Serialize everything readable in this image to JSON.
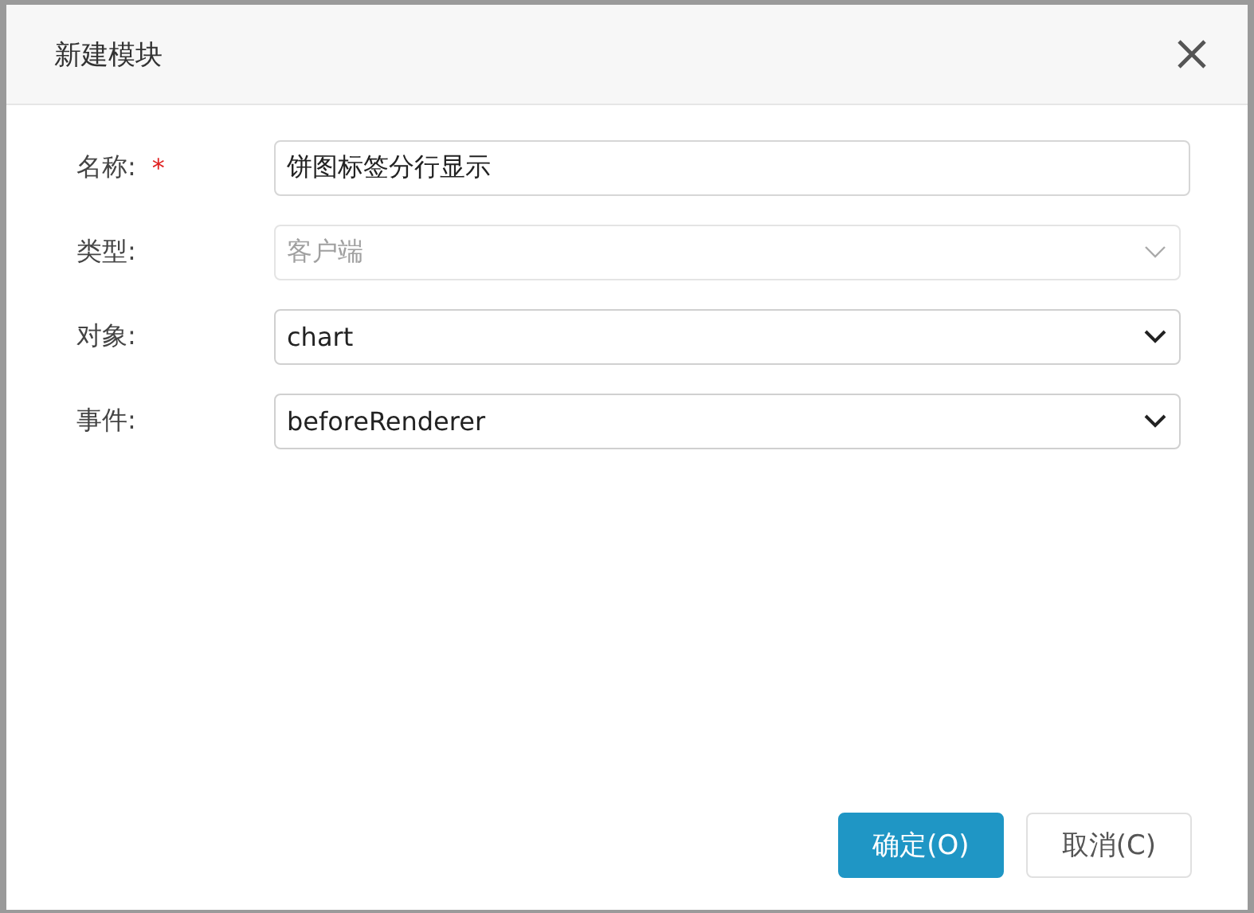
{
  "dialog": {
    "title": "新建模块"
  },
  "required_mark": "*",
  "fields": [
    {
      "kind": "input",
      "label": "名称:",
      "required": true,
      "value": "饼图标签分行显示",
      "disabled": false
    },
    {
      "kind": "select",
      "label": "类型:",
      "required": false,
      "value": "客户端",
      "disabled": true
    },
    {
      "kind": "select",
      "label": "对象:",
      "required": false,
      "value": "chart",
      "disabled": false
    },
    {
      "kind": "select",
      "label": "事件:",
      "required": false,
      "value": "beforeRenderer",
      "disabled": false
    }
  ],
  "buttons": [
    {
      "kind": "primary",
      "label": "确定(O)"
    },
    {
      "kind": "default",
      "label": "取消(C)"
    }
  ]
}
